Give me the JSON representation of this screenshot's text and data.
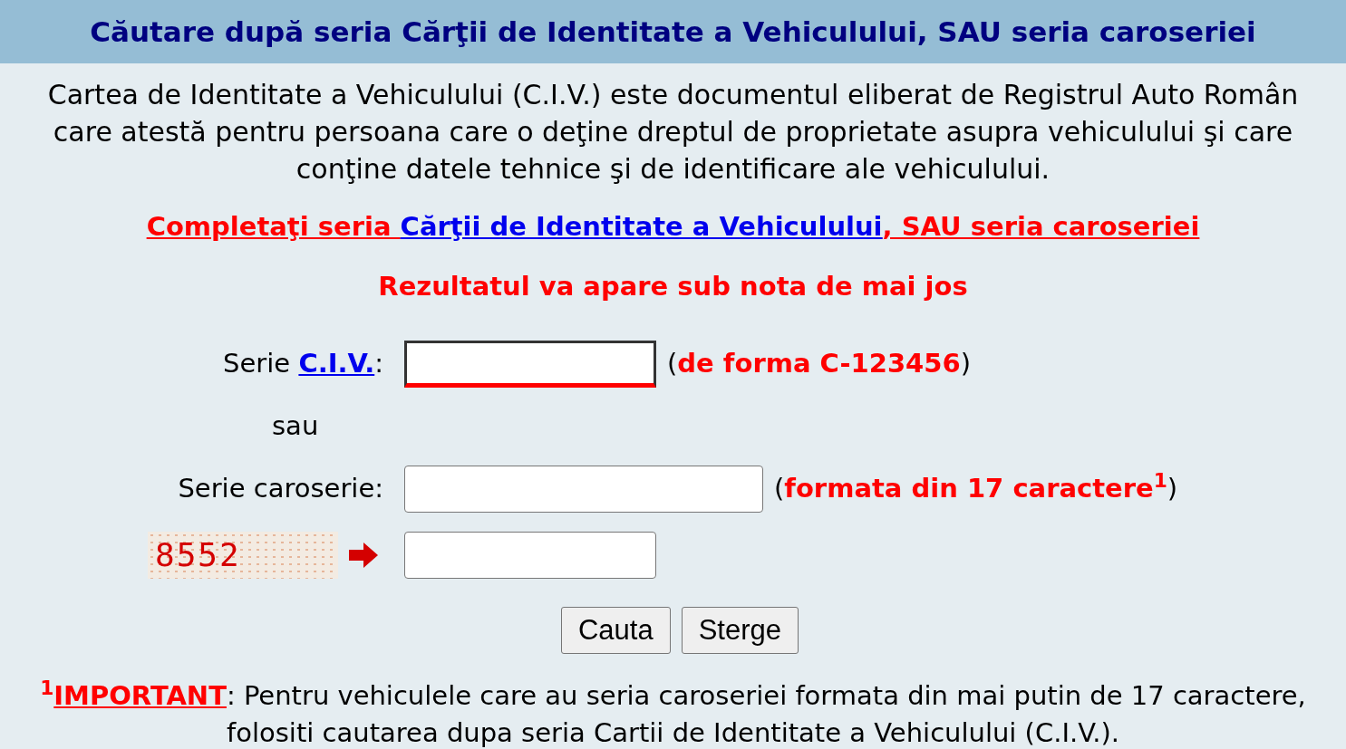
{
  "header": {
    "title": "Căutare după seria Cărţii de Identitate a Vehiculului, SAU seria caroseriei"
  },
  "description": "Cartea de Identitate a Vehiculului (C.I.V.) este documentul eliberat de Registrul Auto Român care atestă pentru persoana care o deţine dreptul de proprietate asupra vehiculului şi care conţine datele tehnice şi de identificare ale vehiculului.",
  "instruction": {
    "before": "Completaţi seria ",
    "link": "Cărţii de Identitate a Vehiculului",
    "after": ", SAU seria caroseriei"
  },
  "notice": "Rezultatul va apare sub nota de mai jos",
  "form": [
    {
      "kind": "short_field",
      "label": "Serie ",
      "link": "C.I.V.",
      "label_end": ":",
      "hint": "(**de forma C-123456**)",
      "highlighted": true
    },
    {
      "kind": "separator",
      "label": "sau"
    },
    {
      "kind": "long_field",
      "label": "Serie caroserie:",
      "hint": "(**formata din 17 caractere**$^{1}$)",
      "highlighted": false
    },
    {
      "kind": "captcha",
      "code": "8552",
      "highlighted": false
    }
  ],
  "buttons": [
    "Cauta",
    "Sterge"
  ],
  "footnote": {
    "mark": "$^{1}$",
    "link": "IMPORTANT",
    "text": ": Pentru vehiculele care au seria caroseriei formata din mai putin de 17 caractere, folositi cautarea dupa seria Cartii de Identitate a Vehiculului (C.I.V.)."
  }
}
